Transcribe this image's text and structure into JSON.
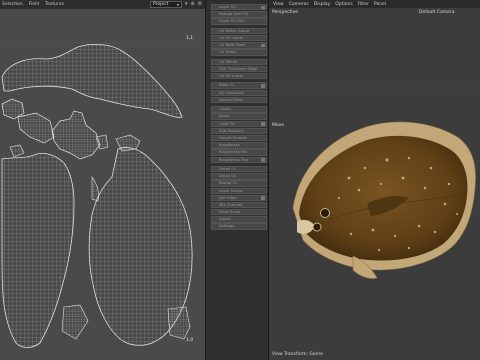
{
  "uv_editor": {
    "menu": [
      "Selection",
      "Field",
      "Textures"
    ],
    "dropdown_value": "Project",
    "tools": [
      "▾",
      "⊕",
      "⚙"
    ],
    "tile_label_top": "1,1",
    "tile_label_bottom": "1,0"
  },
  "layer_list": {
    "items": [
      {
        "label": "Layer 01"
      },
      {
        "label": "Retopo Grid Fill"
      },
      {
        "label": "Layer 02 UVs"
      },
      {
        "label": "UV Stitch Group",
        "gap": true
      },
      {
        "label": "UV Fin Upper"
      },
      {
        "label": "UV Belly Shell"
      },
      {
        "label": "UV Head"
      },
      {
        "label": "UV Mouth",
        "gap": true
      },
      {
        "label": "Fish Thickness Edge"
      },
      {
        "label": "UV Fin Lower"
      },
      {
        "label": "Bake 01",
        "gap": true
      },
      {
        "label": "AO Occlusion"
      },
      {
        "label": "Normal Base"
      },
      {
        "label": "Cavity",
        "gap": true
      },
      {
        "label": "Spots"
      },
      {
        "label": "Color Fill"
      },
      {
        "label": "Sub Displace"
      },
      {
        "label": "Height Smooth"
      },
      {
        "label": "Roughness"
      },
      {
        "label": "Roughness Mix"
      },
      {
        "label": "Roughness Tint"
      },
      {
        "label": "Detail 01",
        "gap": true
      },
      {
        "label": "Detail 02"
      },
      {
        "label": "Stamp 01"
      },
      {
        "label": "Layer Group"
      },
      {
        "label": "Dirt Edge"
      },
      {
        "label": "Mix Channel"
      },
      {
        "label": "Mask Scale"
      },
      {
        "label": "Adjust"
      },
      {
        "label": "Settings"
      }
    ]
  },
  "viewport": {
    "menu": [
      "View",
      "Cameras",
      "Display",
      "Options",
      "Filter",
      "Panel"
    ],
    "camera_mode": "Perspective",
    "camera_name": "Default Camera",
    "move_label": "Move",
    "status_label": "View Transform: Game"
  },
  "colors": {
    "uv_bg": "#4a4a4a",
    "uv_wire": "#d0d0d0",
    "fish_body": "#6b4a1c",
    "fish_fin": "#c9b48a",
    "list_bg": "#2f2f2f"
  }
}
